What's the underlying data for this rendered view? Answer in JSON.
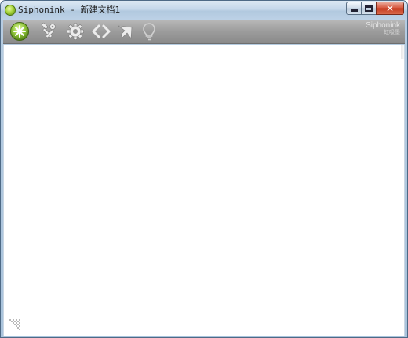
{
  "window": {
    "title": "Siphonink - 新建文档1",
    "controls": {
      "minimize": "minimize",
      "maximize": "maximize",
      "close": "close"
    }
  },
  "toolbar": {
    "tools": [
      {
        "icon": "app-menu-icon"
      },
      {
        "icon": "tools-icon"
      },
      {
        "icon": "gear-icon"
      },
      {
        "icon": "code-brackets-icon"
      },
      {
        "icon": "pointer-arrow-icon"
      },
      {
        "icon": "lightbulb-icon"
      }
    ],
    "brand": {
      "name": "Siphonink",
      "sub": "虹吸墨"
    }
  },
  "colors": {
    "toolbar_bg": "#9c9c9c",
    "accent_green": "#8fc43a",
    "icon_gray": "#e6e6e6",
    "close_red": "#d6543b"
  }
}
